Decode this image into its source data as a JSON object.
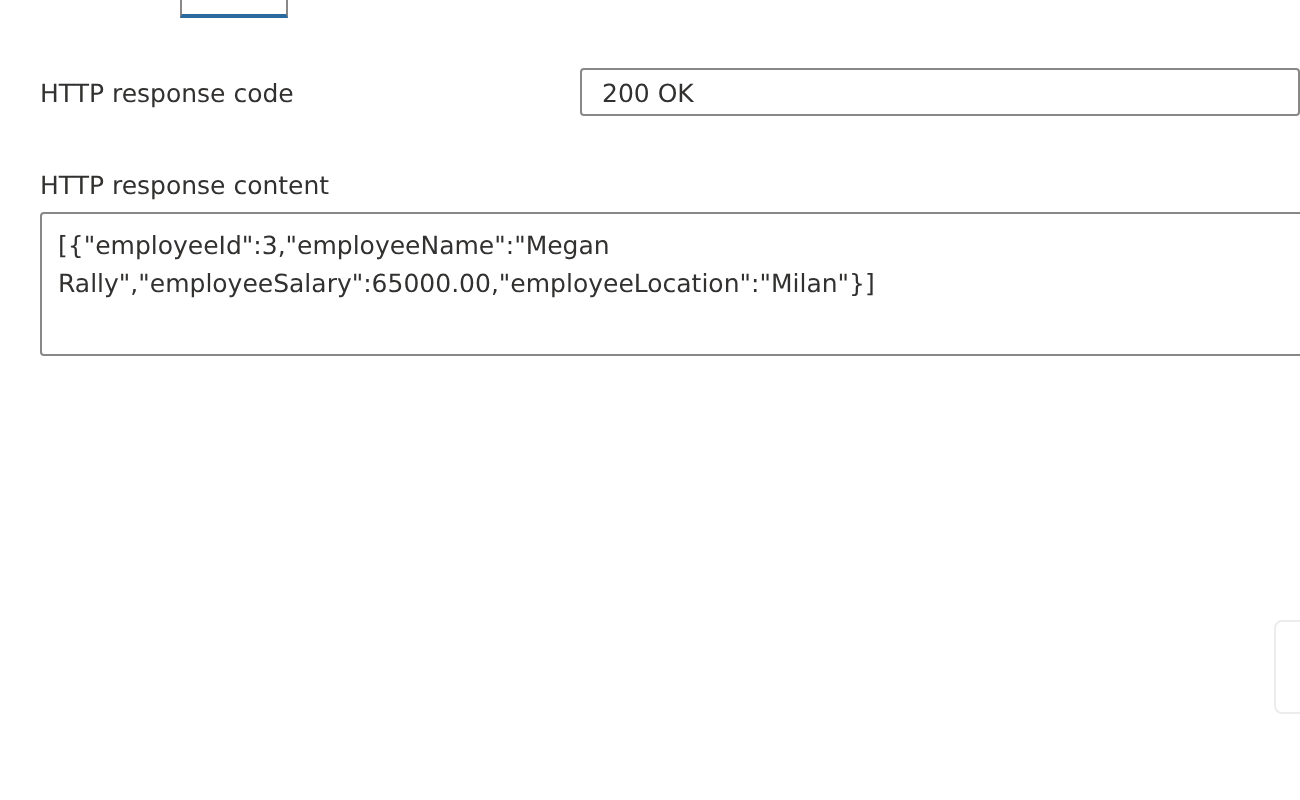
{
  "response_code": {
    "label": "HTTP response code",
    "value": "200 OK"
  },
  "response_content": {
    "label": "HTTP response content",
    "value": "[{\"employeeId\":3,\"employeeName\":\"Megan Rally\",\"employeeSalary\":65000.00,\"employeeLocation\":\"Milan\"}]"
  }
}
